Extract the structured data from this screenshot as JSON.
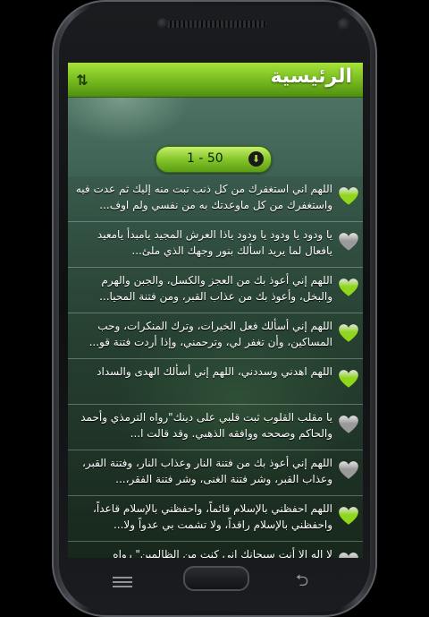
{
  "app": {
    "title": "الرئيسية",
    "sort_icon": "sort-arrows-icon",
    "accent": "#7dc124"
  },
  "pager": {
    "label": "1 - 50",
    "arrow_icon": "arrow-down-icon"
  },
  "device": {
    "back_glyph": "⮌"
  },
  "items": [
    {
      "text": "اللهم اني استغفرك من كل ذنب تبت منه إليك ثم عدت فيه واستغفرك من كل ماوعدتك به من نفسي ولم اوف...",
      "favorite": true
    },
    {
      "text": "يا ودود يا ودود يا ودود ياذا العرش المجيد يامبدأ يامعيد يافعال لما يريد اسألك بنور وجهك الذي ملئ...",
      "favorite": false
    },
    {
      "text": "اللهم إني أعوذ بك من العجز والكسل، والجبن والهرم والبخل، وأعوذ بك من عذاب القبر، ومن فتنة المحيا...",
      "favorite": true
    },
    {
      "text": "اللهم إني أسألك فعل الخيرات، وترك المنكرات، وحب المساكين، وأن تغفر لي، وترحمني، وإذا أردت فتنة قو...",
      "favorite": true
    },
    {
      "text": "اللهم اهدني وسددني، اللهم إني أسألك الهدى والسداد",
      "favorite": true
    },
    {
      "text": "يا مقلب القلوب ثبت قلبي على دينك\"رواه الترمذي وأحمد والحاكم وصححه ووافقه الذهبي. وقد قالت ا...",
      "favorite": false
    },
    {
      "text": "اللهم إني أعوذ بك من فتنة النار وعذاب النار، وفتنة القبر، وعذاب القبر، وشر فتنة الغنى، وشر فتنة الفقر،...",
      "favorite": false
    },
    {
      "text": "اللهم احفظني بالإسلام قائماً، واحفظني بالإسلام قاعداً، واحفظني بالإسلام راقداً، ولا تشمت بي عدواً ولا...",
      "favorite": true
    },
    {
      "text": "لا إله إلا أنت سبحانك إني كنت من الظالمين\" رواه",
      "favorite": false
    }
  ],
  "colors": {
    "heart_green": "#8fd61c",
    "heart_gray": "#9a9a9a"
  }
}
